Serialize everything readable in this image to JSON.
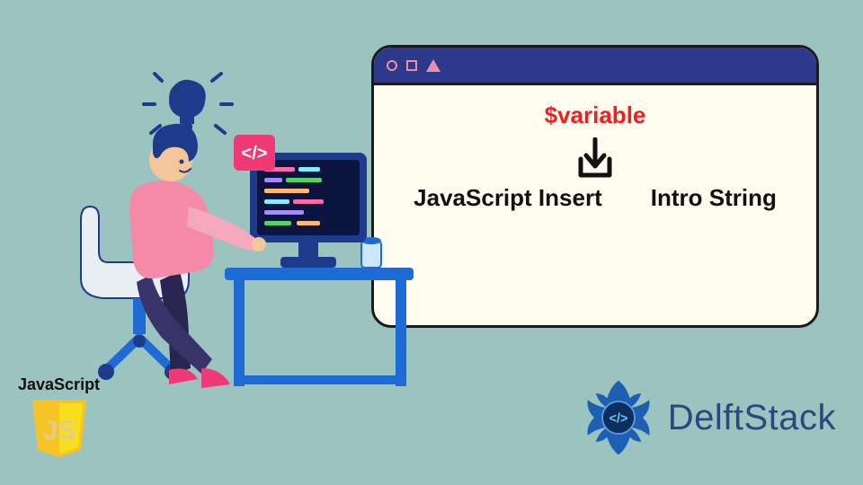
{
  "window": {
    "variable_label": "$variable",
    "text_left": "JavaScript Insert",
    "text_right": "Intro String"
  },
  "js_badge": {
    "label": "JavaScript",
    "shield_text": "JS"
  },
  "brand": {
    "name": "DelftStack",
    "tag_glyph": "</>"
  },
  "icons": {
    "lightbulb": "lightbulb",
    "code_tag": "</>"
  }
}
